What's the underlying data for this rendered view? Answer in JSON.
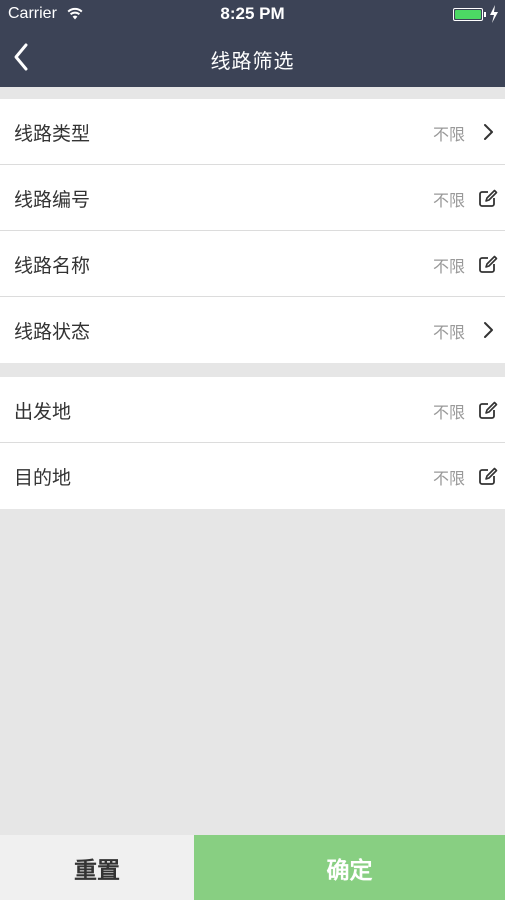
{
  "status_bar": {
    "carrier": "Carrier",
    "time": "8:25 PM",
    "battery_color": "#4cd964"
  },
  "nav": {
    "title": "线路筛选",
    "back_icon": "chevron-left-icon",
    "background": "#3c4356"
  },
  "groups": [
    {
      "rows": [
        {
          "label": "线路类型",
          "value": "不限",
          "icon": "chevron-right-icon"
        },
        {
          "label": "线路编号",
          "value": "不限",
          "icon": "edit-icon"
        },
        {
          "label": "线路名称",
          "value": "不限",
          "icon": "edit-icon"
        },
        {
          "label": "线路状态",
          "value": "不限",
          "icon": "chevron-right-icon"
        }
      ]
    },
    {
      "rows": [
        {
          "label": "出发地",
          "value": "不限",
          "icon": "edit-icon"
        },
        {
          "label": "目的地",
          "value": "不限",
          "icon": "edit-icon"
        }
      ]
    }
  ],
  "buttons": {
    "reset_label": "重置",
    "confirm_label": "确定",
    "confirm_color": "#88cf82"
  }
}
